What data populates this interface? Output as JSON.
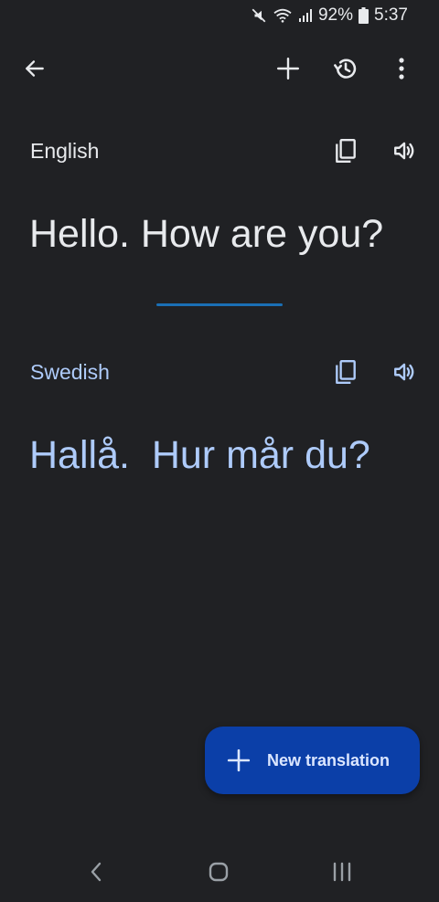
{
  "status_bar": {
    "battery": "92%",
    "time": "5:37",
    "icons": [
      "mute-icon",
      "wifi-icon",
      "signal-icon",
      "battery-icon"
    ]
  },
  "app_bar": {
    "icons": [
      "back-arrow-icon",
      "plus-icon",
      "history-icon",
      "more-vert-icon"
    ]
  },
  "source": {
    "language": "English",
    "text": "Hello. How are you?"
  },
  "target": {
    "language": "Swedish",
    "text": "Hallå.  Hur mår du?"
  },
  "fab": {
    "label": "New translation"
  },
  "nav_bar": {
    "icons": [
      "nav-back-icon",
      "nav-home-icon",
      "nav-recents-icon"
    ]
  },
  "colors": {
    "background": "#202124",
    "primary_text": "#e8eaed",
    "accent_text": "#aecbfa",
    "fab": "#0b3fa8",
    "divider": "#1a6fb5"
  }
}
